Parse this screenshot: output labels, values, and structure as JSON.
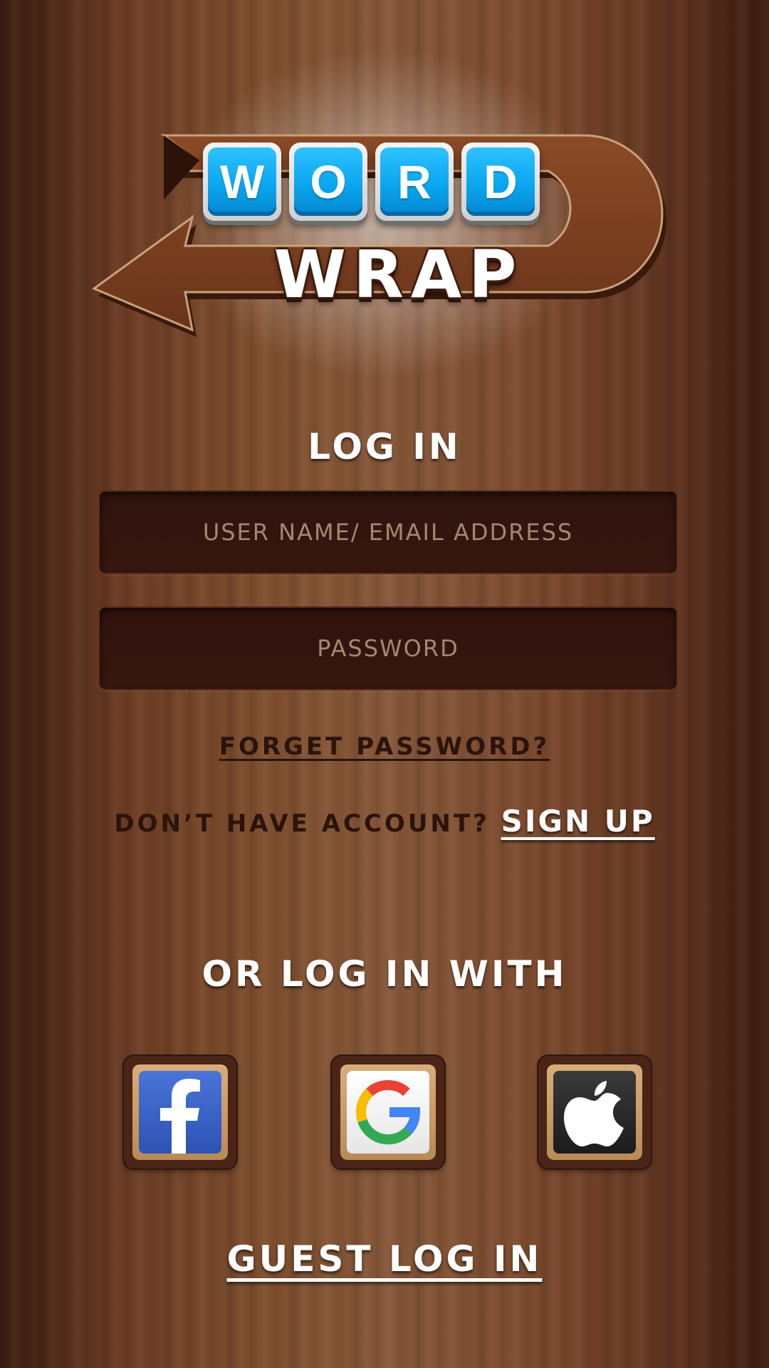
{
  "logo": {
    "tiles": [
      "W",
      "O",
      "R",
      "D"
    ],
    "subtitle": "WRAP"
  },
  "login": {
    "title": "LOG IN",
    "username_placeholder": "USER NAME/ EMAIL ADDRESS",
    "password_placeholder": "PASSWORD",
    "forgot_password": "FORGET PASSWORD?",
    "no_account_text": "DON’T HAVE ACCOUNT?",
    "sign_up": "SIGN UP"
  },
  "social": {
    "title": "OR LOG IN WITH",
    "providers": [
      {
        "name": "facebook",
        "icon": "facebook-icon",
        "color": "#3b5fc6"
      },
      {
        "name": "google",
        "icon": "google-icon",
        "color": "#f2f2f2"
      },
      {
        "name": "apple",
        "icon": "apple-icon",
        "color": "#262626"
      }
    ]
  },
  "guest_login": "GUEST LOG IN"
}
